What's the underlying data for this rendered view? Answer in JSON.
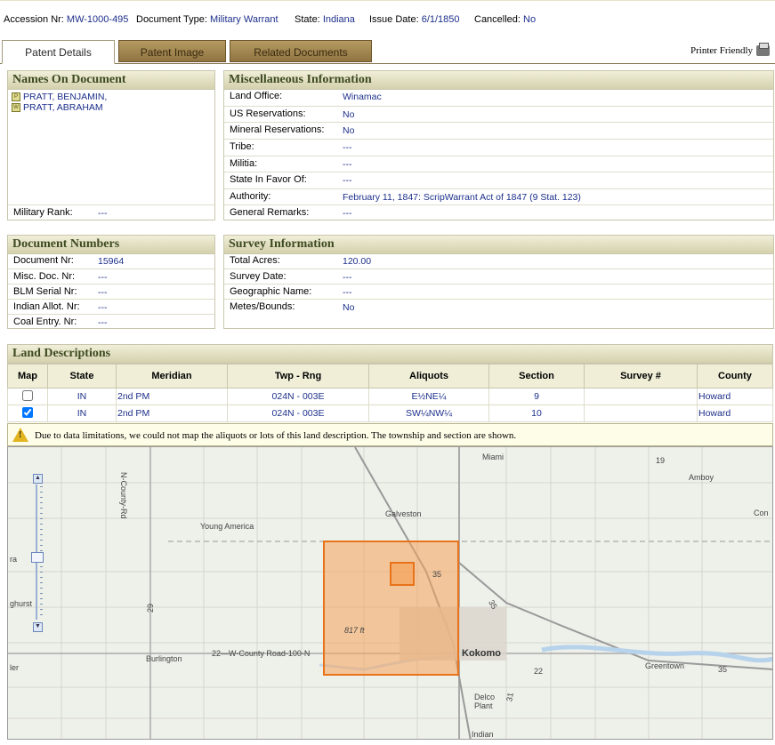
{
  "header": {
    "accession_label": "Accession Nr:",
    "accession_value": "MW-1000-495",
    "doctype_label": "Document Type:",
    "doctype_value": "Military Warrant",
    "state_label": "State:",
    "state_value": "Indiana",
    "issue_label": "Issue Date:",
    "issue_value": "6/1/1850",
    "cancelled_label": "Cancelled:",
    "cancelled_value": "No"
  },
  "tabs": [
    "Patent Details",
    "Patent Image",
    "Related Documents"
  ],
  "printer_friendly": "Printer Friendly",
  "names_panel": {
    "title": "Names On Document",
    "names": [
      {
        "badge": "P",
        "name": "PRATT, BENJAMIN,"
      },
      {
        "badge": "W",
        "name": "PRATT, ABRAHAM"
      }
    ],
    "military_rank_label": "Military Rank:",
    "military_rank_value": "---"
  },
  "misc_panel": {
    "title": "Miscellaneous Information",
    "rows": [
      {
        "label": "Land Office:",
        "value": "Winamac"
      },
      {
        "label": "US Reservations:",
        "value": "No"
      },
      {
        "label": "Mineral Reservations:",
        "value": "No"
      },
      {
        "label": "Tribe:",
        "value": "---"
      },
      {
        "label": "Militia:",
        "value": "---"
      },
      {
        "label": "State In Favor Of:",
        "value": "---"
      },
      {
        "label": "Authority:",
        "value": "February 11, 1847: ScripWarrant Act of 1847 (9 Stat. 123)"
      },
      {
        "label": "General Remarks:",
        "value": "---"
      }
    ]
  },
  "docnum_panel": {
    "title": "Document Numbers",
    "rows": [
      {
        "label": "Document Nr:",
        "value": "15964"
      },
      {
        "label": "Misc. Doc. Nr:",
        "value": "---"
      },
      {
        "label": "BLM Serial Nr:",
        "value": "---"
      },
      {
        "label": "Indian Allot. Nr:",
        "value": "---"
      },
      {
        "label": "Coal Entry. Nr:",
        "value": "---"
      }
    ]
  },
  "survey_panel": {
    "title": "Survey Information",
    "rows": [
      {
        "label": "Total Acres:",
        "value": "120.00"
      },
      {
        "label": "Survey Date:",
        "value": "---"
      },
      {
        "label": "Geographic Name:",
        "value": "---"
      },
      {
        "label": "Metes/Bounds:",
        "value": "No"
      }
    ]
  },
  "land": {
    "title": "Land Descriptions",
    "columns": [
      "Map",
      "State",
      "Meridian",
      "Twp - Rng",
      "Aliquots",
      "Section",
      "Survey #",
      "County"
    ],
    "rows": [
      {
        "checked": false,
        "state": "IN",
        "meridian": "2nd PM",
        "twp": "024N - 003E",
        "aliquots": "E½NE¼",
        "section": "9",
        "survey": "",
        "county": "Howard"
      },
      {
        "checked": true,
        "state": "IN",
        "meridian": "2nd PM",
        "twp": "024N - 003E",
        "aliquots": "SW¼NW¼",
        "section": "10",
        "survey": "",
        "county": "Howard"
      }
    ],
    "notice": "Due to data limitations, we could not map the aliquots or lots of this land description. The township and section are shown."
  },
  "map": {
    "labels": [
      "Miami",
      "Galveston",
      "Young America",
      "Amboy",
      "Kokomo",
      "Burlington",
      "Greentown",
      "Delco Plant",
      "Indian",
      "817 ft",
      "22—W-County Road-100-N",
      "N-County-Rd",
      "ra",
      "ghurst",
      "ler",
      "Con",
      "19",
      "35",
      "35",
      "35",
      "29",
      "22",
      "31"
    ],
    "colors": {
      "township": "#f5a25a",
      "outline": "#e8731a"
    }
  }
}
